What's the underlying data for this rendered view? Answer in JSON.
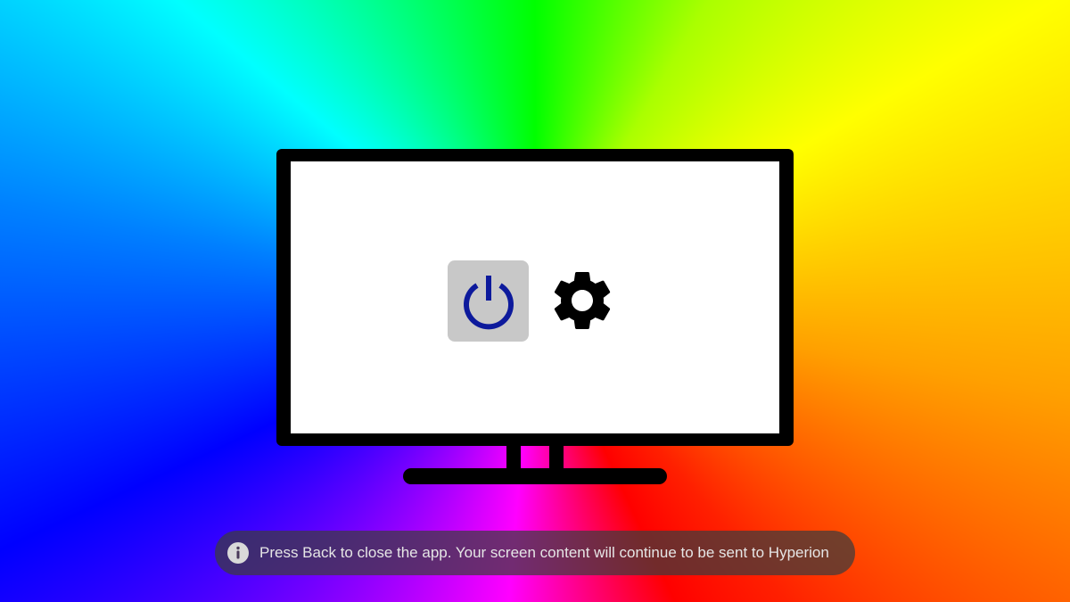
{
  "app": {
    "name": "Hyperion"
  },
  "controls": {
    "power_icon": "power-icon",
    "power_color": "#0d1a9c",
    "power_bg_color": "#c8c8c8",
    "settings_icon": "gear-icon"
  },
  "toast": {
    "icon": "info-icon",
    "message": "Press Back to close the app. Your screen content will continue to be sent to Hyperion"
  }
}
